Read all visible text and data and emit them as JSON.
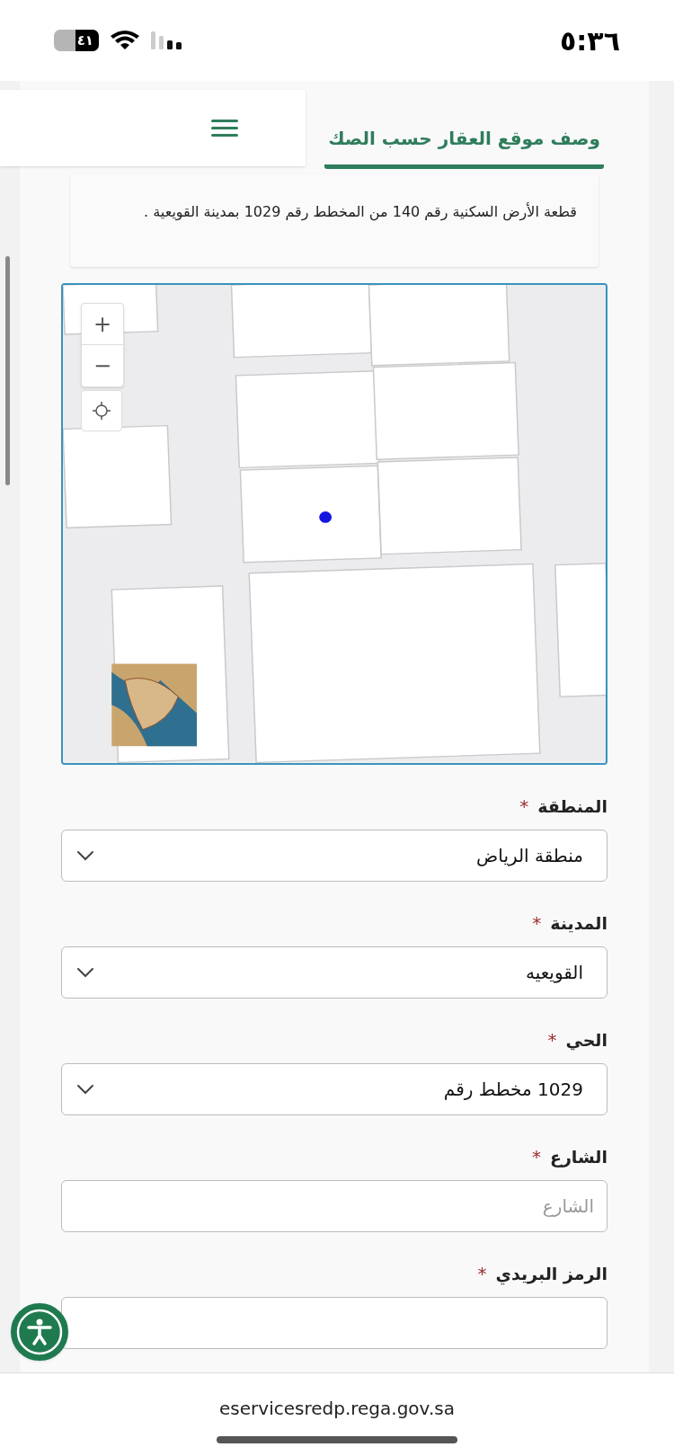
{
  "status_bar": {
    "time": "٥:٣٦",
    "battery": "٤١"
  },
  "header": {
    "tab": {
      "label": "وصف موقع العقار حسب الصك",
      "selected": true
    }
  },
  "description": "قطعة الأرض السكنية رقم 140 من المخطط رقم 1029 بمدينة القويعية .",
  "map": {
    "zoom_in": "+",
    "zoom_out": "−"
  },
  "fields": [
    {
      "label": "المنطقة",
      "mark": "*",
      "kind": "select",
      "value": "منطقة الرياض"
    },
    {
      "label": "المدينة",
      "mark": "*",
      "kind": "select",
      "value": "القويعيه"
    },
    {
      "label": "الحي",
      "mark": "*",
      "kind": "select",
      "value": "1029 مخطط رقم"
    },
    {
      "label": "الشارع",
      "mark": "*",
      "kind": "text",
      "placeholder": "الشارع"
    },
    {
      "label": "الرمز البريدي",
      "mark": "*",
      "kind": "text"
    }
  ],
  "browser": {
    "url": "eservicesredp.rega.gov.sa"
  }
}
